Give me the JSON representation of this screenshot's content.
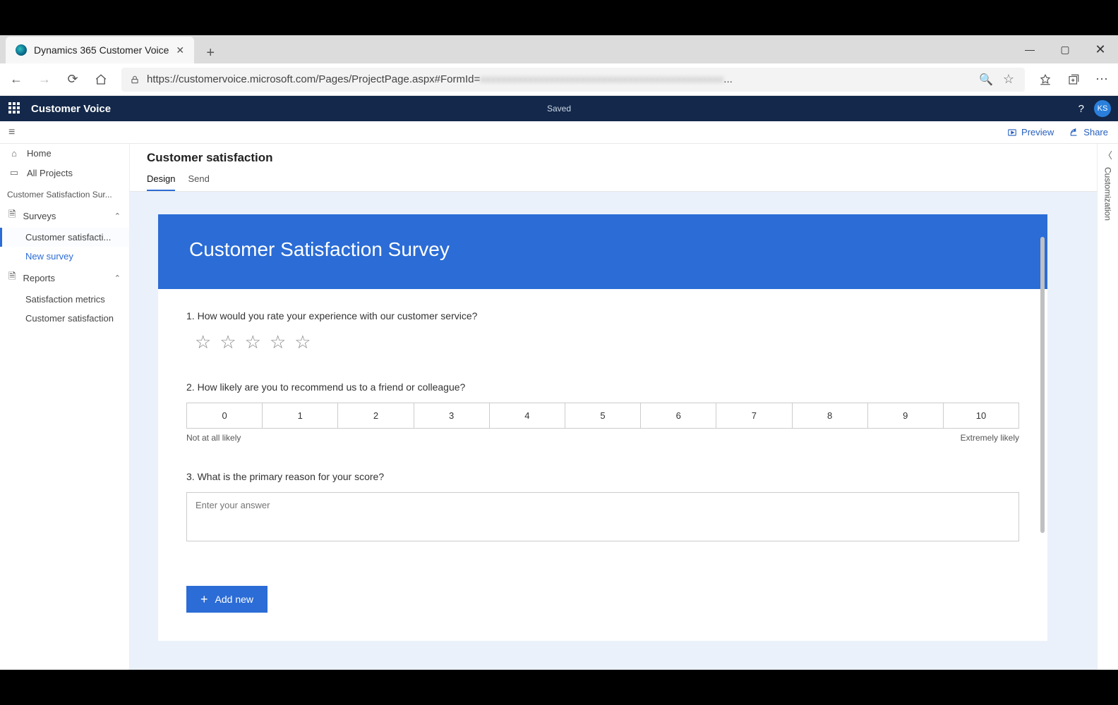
{
  "browser": {
    "tab_title": "Dynamics 365 Customer Voice",
    "url": "https://customervoice.microsoft.com/Pages/ProjectPage.aspx#FormId=",
    "url_suffix": "..."
  },
  "appheader": {
    "name": "Customer Voice",
    "status": "Saved",
    "help": "?",
    "avatar": "KS"
  },
  "commandbar": {
    "preview": "Preview",
    "share": "Share"
  },
  "sidebar": {
    "home": "Home",
    "all_projects": "All Projects",
    "project_name": "Customer Satisfaction Sur...",
    "surveys_label": "Surveys",
    "survey_item": "Customer satisfacti...",
    "new_survey": "New survey",
    "reports_label": "Reports",
    "report_items": [
      "Satisfaction metrics",
      "Customer satisfaction"
    ]
  },
  "page": {
    "title": "Customer satisfaction",
    "tabs": {
      "design": "Design",
      "send": "Send"
    }
  },
  "form": {
    "hero_title": "Customer Satisfaction Survey",
    "q1": {
      "num": "1.",
      "text": "How would you rate your experience with our customer service?"
    },
    "q2": {
      "num": "2.",
      "text": "How likely are you to recommend us to a friend or colleague?",
      "scale": [
        "0",
        "1",
        "2",
        "3",
        "4",
        "5",
        "6",
        "7",
        "8",
        "9",
        "10"
      ],
      "low": "Not at all likely",
      "high": "Extremely likely"
    },
    "q3": {
      "num": "3.",
      "text": "What is the primary reason for your score?",
      "placeholder": "Enter your answer"
    },
    "add_new": "Add new"
  },
  "right_rail": {
    "label": "Customization"
  }
}
